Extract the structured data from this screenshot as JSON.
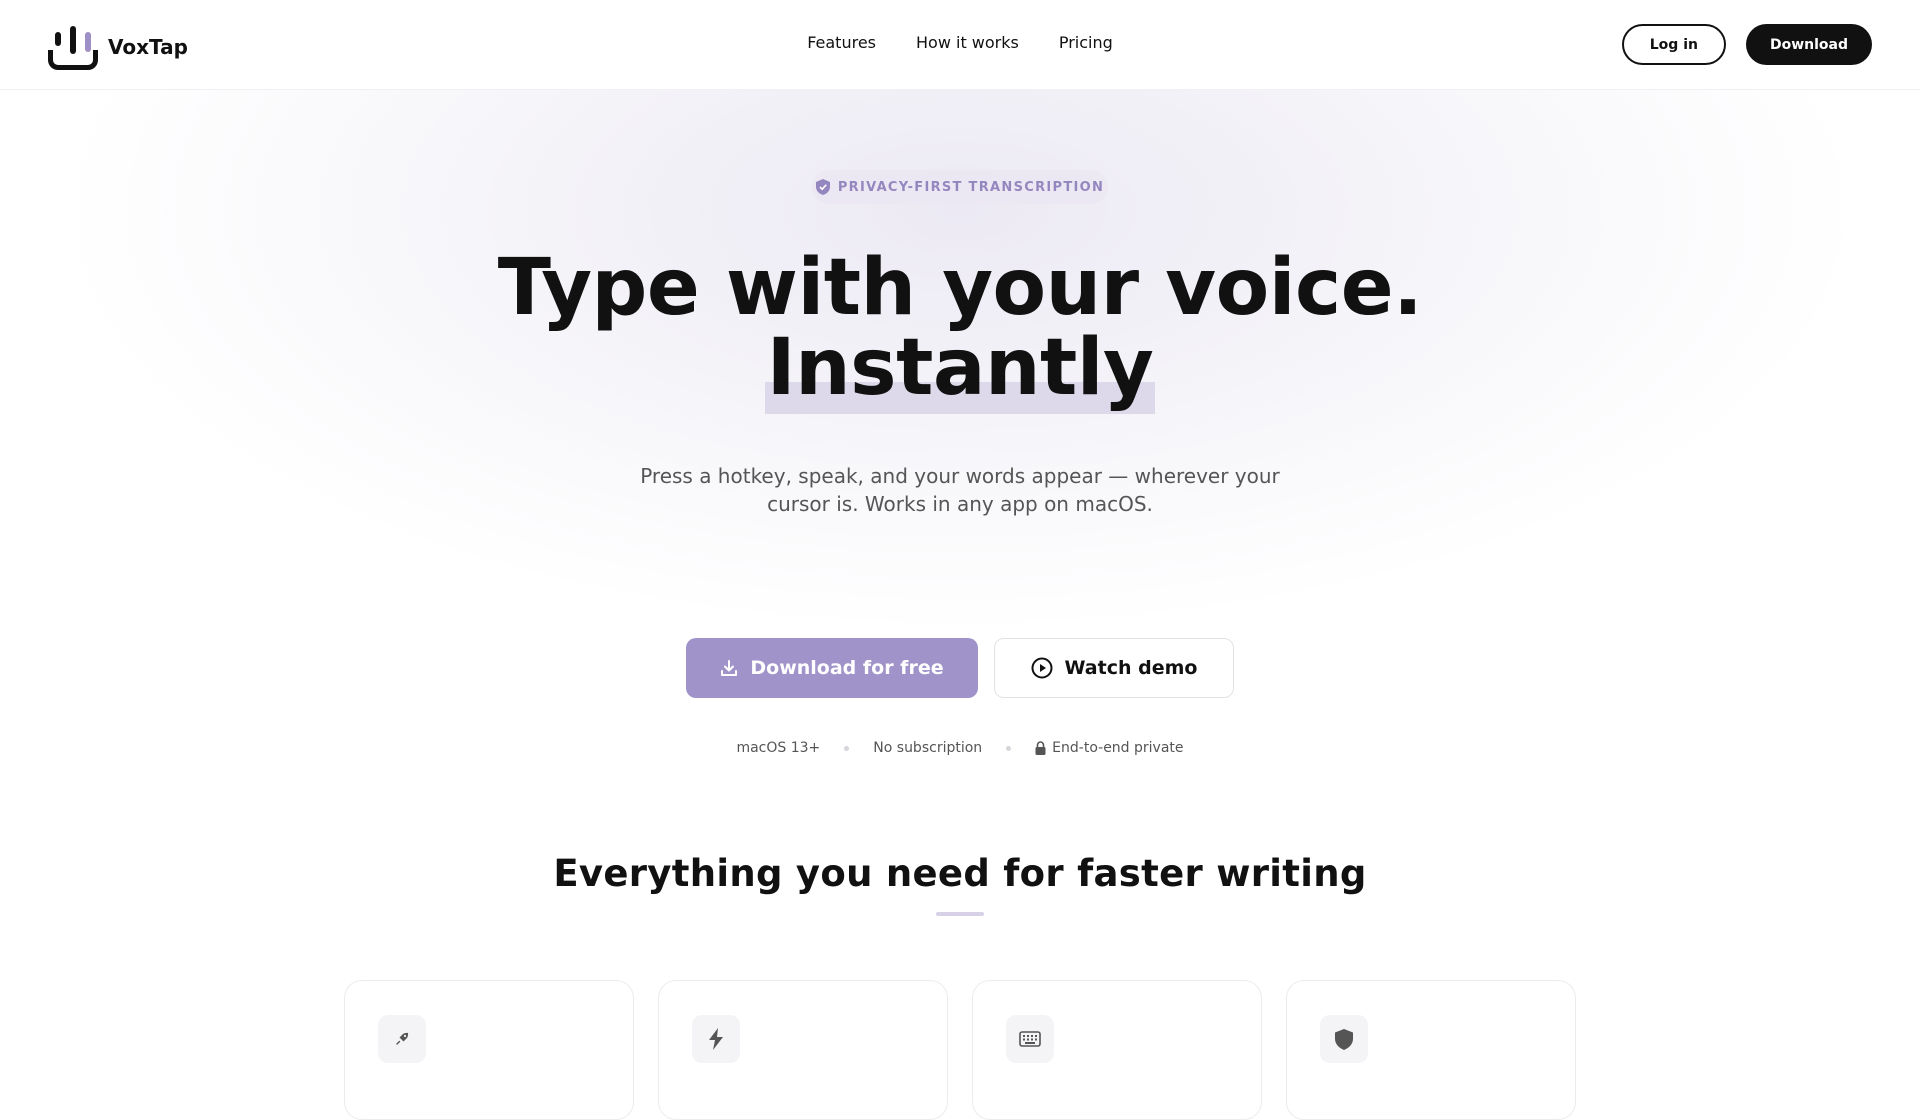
{
  "brand": {
    "name": "VoxTap"
  },
  "nav": {
    "items": [
      "Features",
      "How it works",
      "Pricing"
    ]
  },
  "header_actions": {
    "login_label": "Log in",
    "download_label": "Download"
  },
  "hero": {
    "badge": "PRIVACY-FIRST TRANSCRIPTION",
    "headline_line1": "Type with your voice.",
    "headline_line2": "Instantly",
    "subtitle": "Press a hotkey, speak, and your words appear — wherever your cursor is. Works in any app on macOS.",
    "primary_cta": "Download for free",
    "secondary_cta": "Watch demo",
    "meta": [
      "macOS 13+",
      "No subscription",
      "End-to-end private"
    ]
  },
  "features": {
    "title": "Everything you need for faster writing",
    "cards": [
      {
        "icon": "rocket-icon"
      },
      {
        "icon": "lightning-icon"
      },
      {
        "icon": "keyboard-icon"
      },
      {
        "icon": "shield-icon"
      }
    ]
  },
  "colors": {
    "accent": "#a093c9",
    "accent_text": "#9487bf",
    "highlight": "#ddd8ea",
    "dark": "#111111"
  }
}
